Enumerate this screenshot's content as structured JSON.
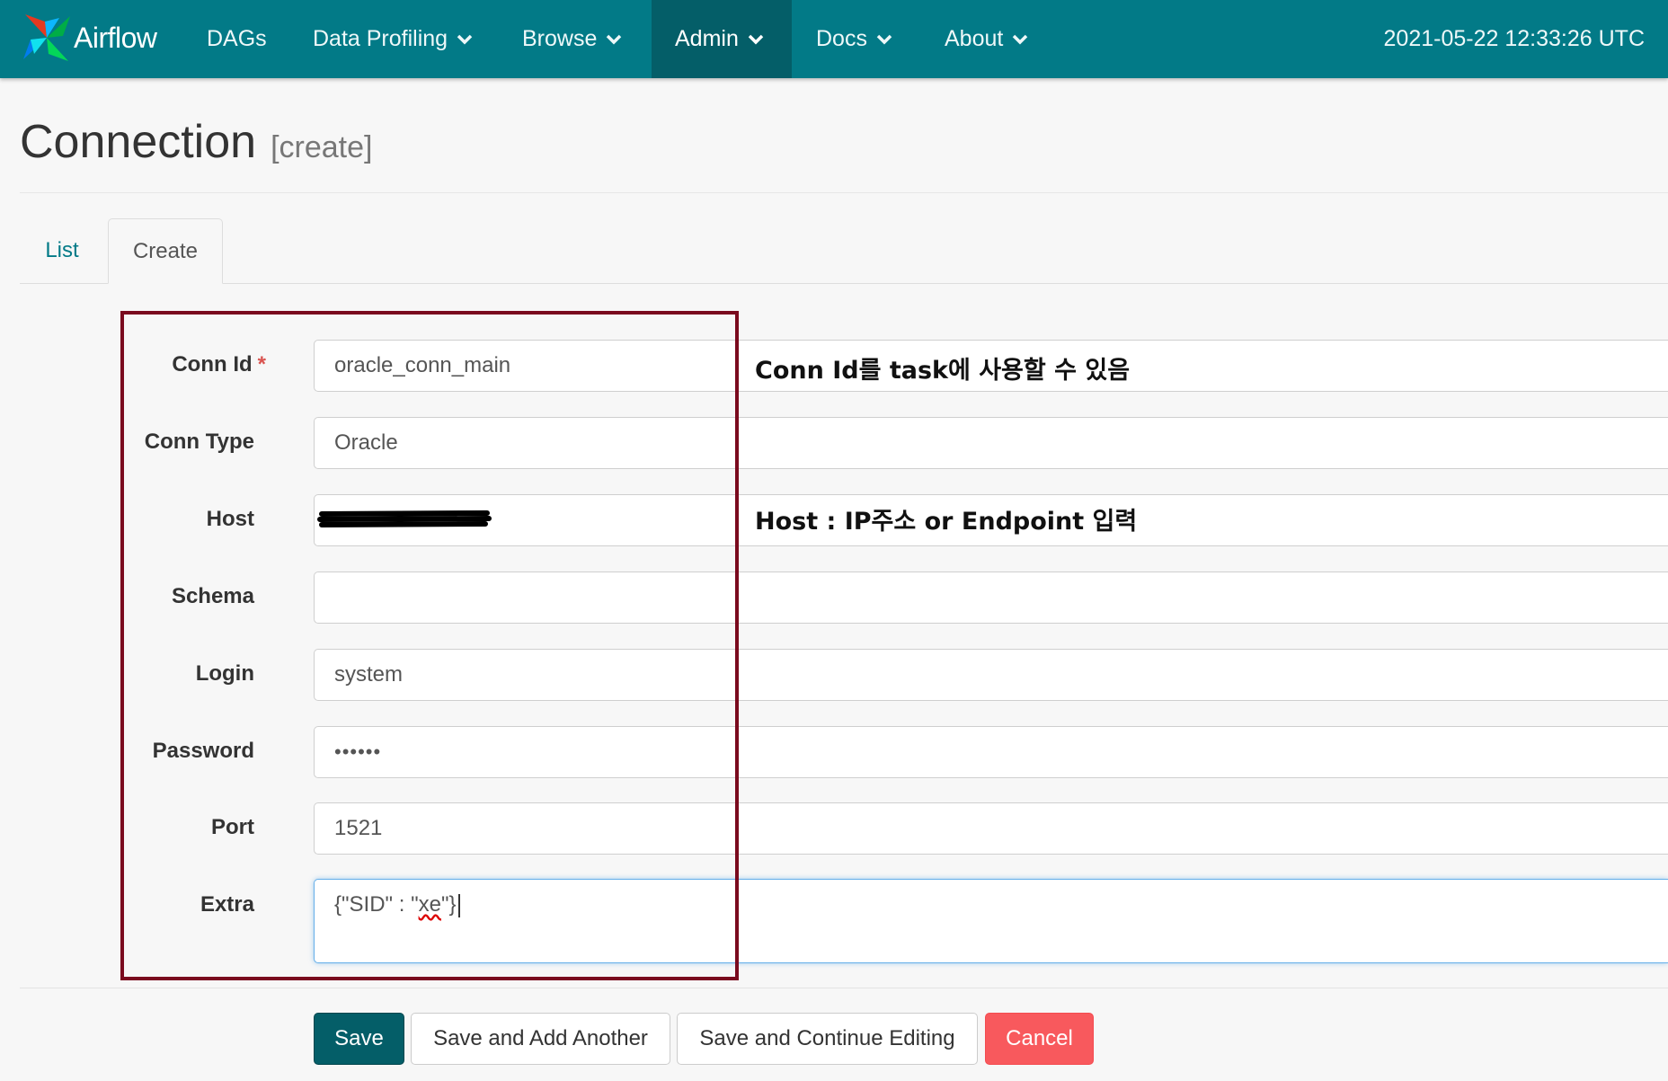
{
  "navbar": {
    "brand": "Airflow",
    "items": [
      "DAGs",
      "Data Profiling",
      "Browse",
      "Admin",
      "Docs",
      "About"
    ],
    "clock": "2021-05-22 12:33:26 UTC",
    "colors": {
      "bar": "#027a87",
      "active": "#045e68"
    }
  },
  "header": {
    "title": "Connection",
    "subtitle": "[create]"
  },
  "tabs": [
    "List",
    "Create"
  ],
  "form": {
    "labels": {
      "conn_id": "Conn Id",
      "conn_type": "Conn Type",
      "host": "Host",
      "schema": "Schema",
      "login": "Login",
      "password": "Password",
      "port": "Port",
      "extra": "Extra"
    },
    "required_mark": "*",
    "values": {
      "conn_id": "oracle_conn_main",
      "conn_type": "Oracle",
      "host": "",
      "schema": "",
      "login": "system",
      "password": "••••••",
      "port": "1521",
      "extra_prefix": "{\"SID\" : \"",
      "extra_word": "xe",
      "extra_suffix": "\"}"
    }
  },
  "annotations": {
    "conn_id_note": "Conn Id를 task에 사용할 수 있음",
    "host_note": "Host : IP주소 or Endpoint 입력"
  },
  "buttons": {
    "save": "Save",
    "save_add": "Save and Add Another",
    "save_continue": "Save and Continue Editing",
    "cancel": "Cancel"
  }
}
